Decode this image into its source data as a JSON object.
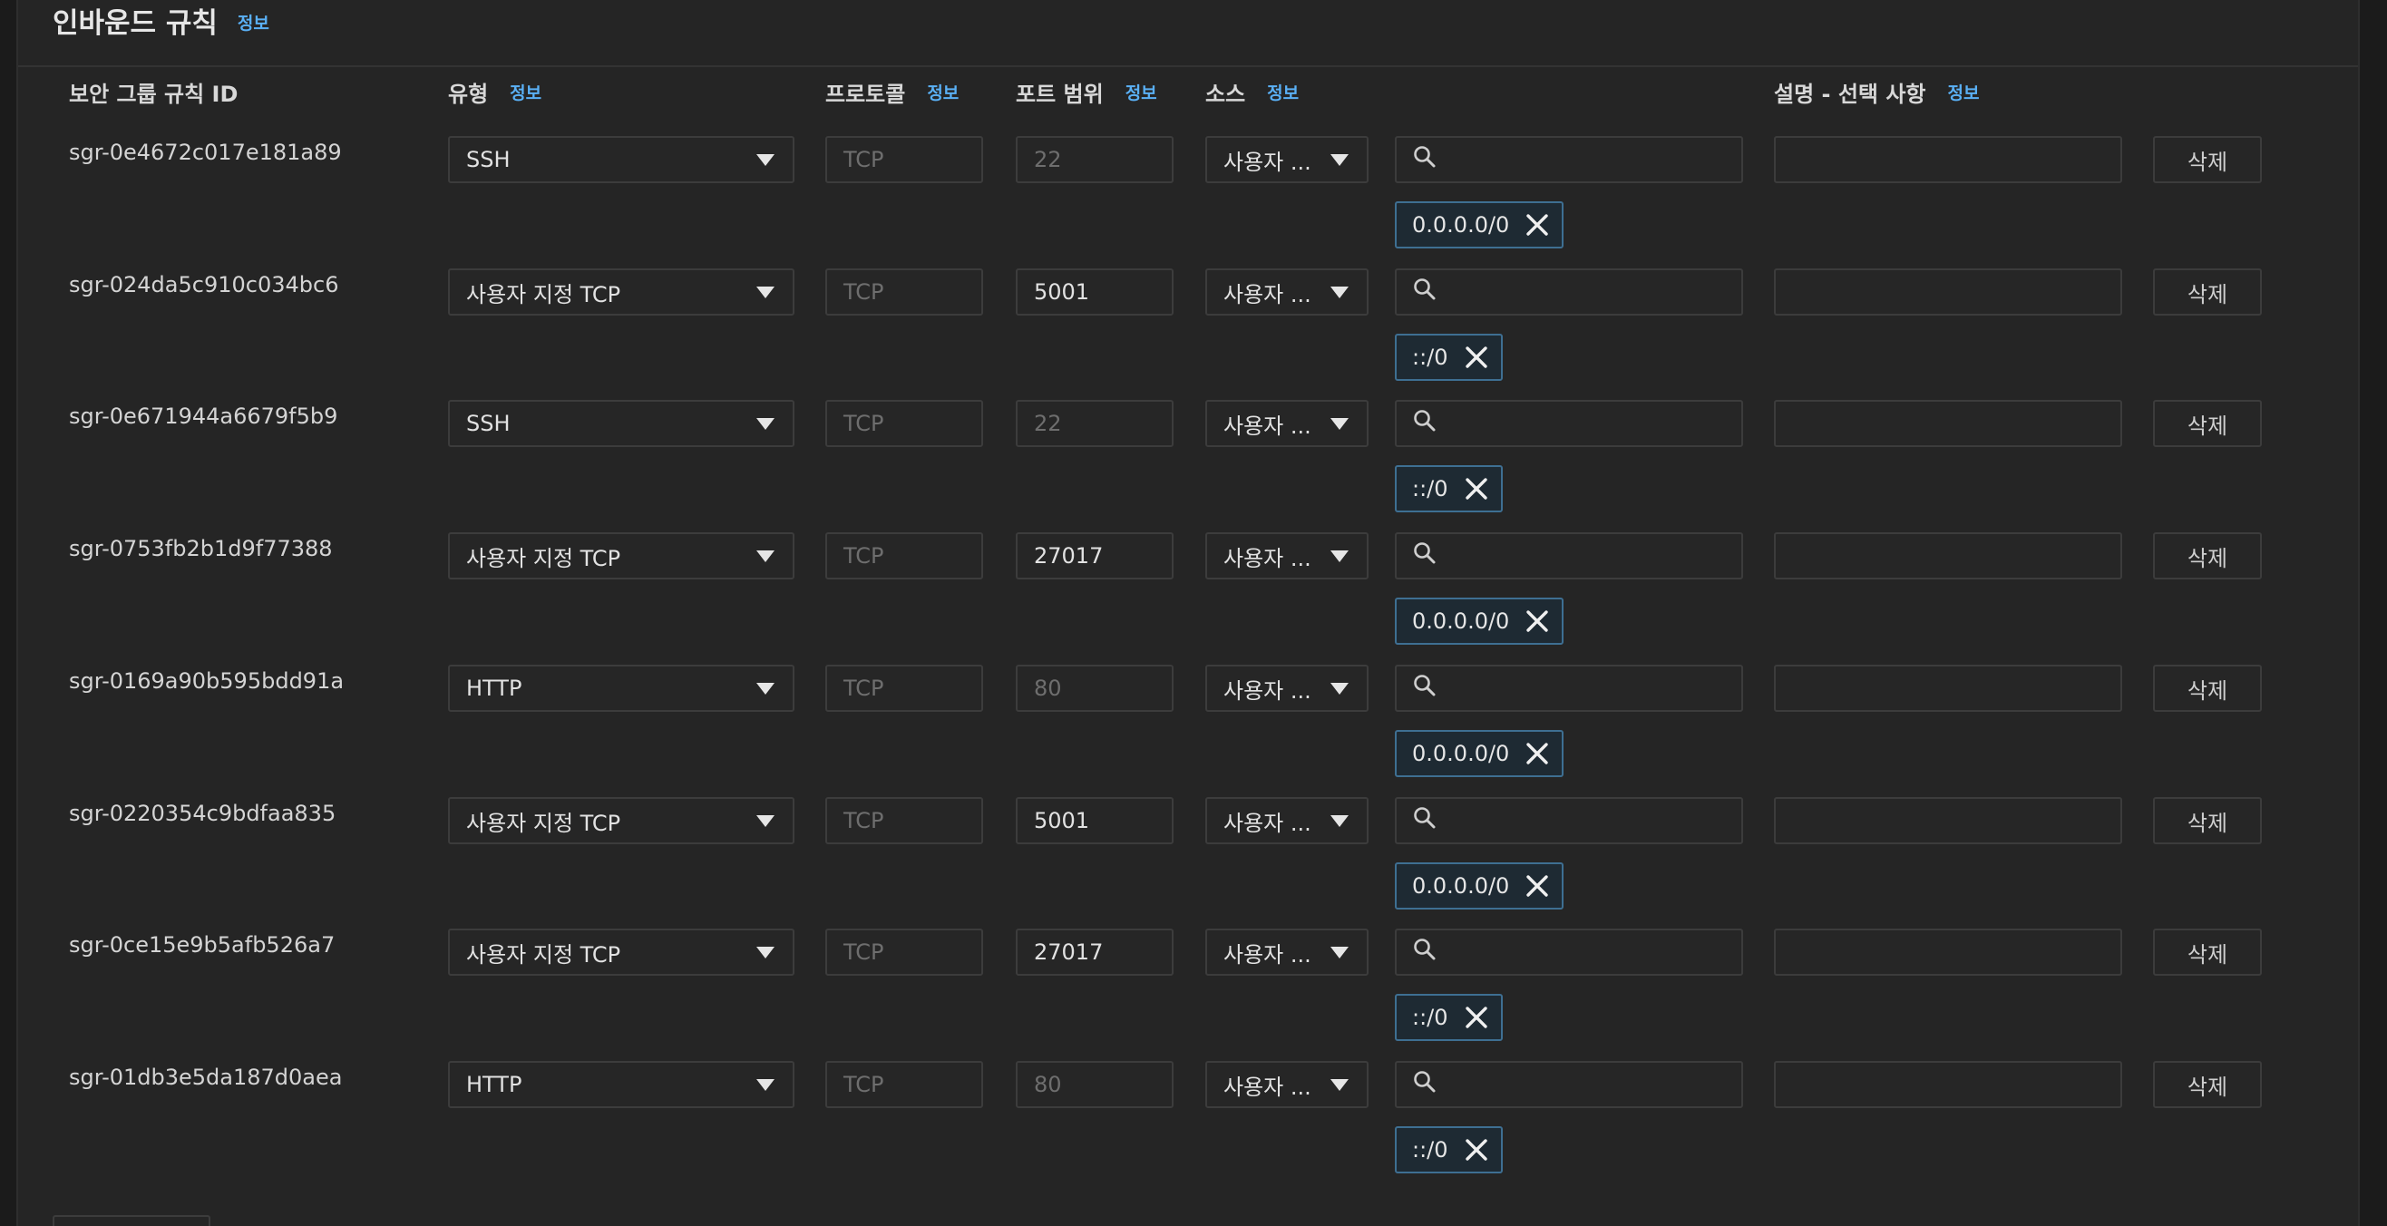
{
  "panel": {
    "title": "인바운드 규칙",
    "info_label": "정보"
  },
  "columns": {
    "rule_id": "보안 그룹 규칙 ID",
    "type": "유형",
    "protocol": "프로토콜",
    "port_range": "포트 범위",
    "source": "소스",
    "description": "설명 - 선택 사항",
    "info": "정보"
  },
  "icons": {
    "dropdown": "chevron-down-icon",
    "search": "search-icon",
    "remove": "close-icon"
  },
  "colors": {
    "background": "#252525",
    "info_link": "#5ab0f5",
    "token_border": "#3e6f92"
  },
  "delete_label": "삭제",
  "rows": [
    {
      "id": "sgr-0e4672c017e181a89",
      "type": "SSH",
      "protocol": "TCP",
      "port": "22",
      "port_editable": false,
      "source": "사용자 ...",
      "search_value": "",
      "cidr": "0.0.0.0/0",
      "description": ""
    },
    {
      "id": "sgr-024da5c910c034bc6",
      "type": "사용자 지정 TCP",
      "protocol": "TCP",
      "port": "5001",
      "port_editable": true,
      "source": "사용자 ...",
      "search_value": "",
      "cidr": "::/0",
      "description": ""
    },
    {
      "id": "sgr-0e671944a6679f5b9",
      "type": "SSH",
      "protocol": "TCP",
      "port": "22",
      "port_editable": false,
      "source": "사용자 ...",
      "search_value": "",
      "cidr": "::/0",
      "description": ""
    },
    {
      "id": "sgr-0753fb2b1d9f77388",
      "type": "사용자 지정 TCP",
      "protocol": "TCP",
      "port": "27017",
      "port_editable": true,
      "source": "사용자 ...",
      "search_value": "",
      "cidr": "0.0.0.0/0",
      "description": ""
    },
    {
      "id": "sgr-0169a90b595bdd91a",
      "type": "HTTP",
      "protocol": "TCP",
      "port": "80",
      "port_editable": false,
      "source": "사용자 ...",
      "search_value": "",
      "cidr": "0.0.0.0/0",
      "description": ""
    },
    {
      "id": "sgr-0220354c9bdfaa835",
      "type": "사용자 지정 TCP",
      "protocol": "TCP",
      "port": "5001",
      "port_editable": true,
      "source": "사용자 ...",
      "search_value": "",
      "cidr": "0.0.0.0/0",
      "description": ""
    },
    {
      "id": "sgr-0ce15e9b5afb526a7",
      "type": "사용자 지정 TCP",
      "protocol": "TCP",
      "port": "27017",
      "port_editable": true,
      "source": "사용자 ...",
      "search_value": "",
      "cidr": "::/0",
      "description": ""
    },
    {
      "id": "sgr-01db3e5da187d0aea",
      "type": "HTTP",
      "protocol": "TCP",
      "port": "80",
      "port_editable": false,
      "source": "사용자 ...",
      "search_value": "",
      "cidr": "::/0",
      "description": ""
    }
  ]
}
